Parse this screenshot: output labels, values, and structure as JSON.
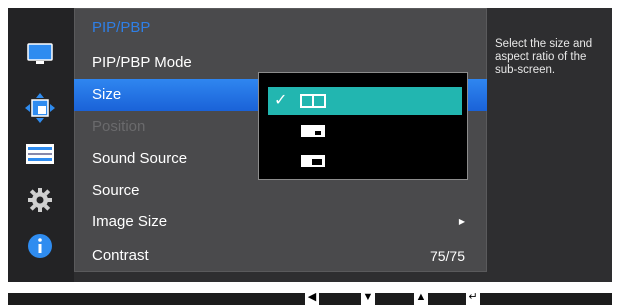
{
  "menu": {
    "title": "PIP/PBP",
    "items": [
      {
        "label": "PIP/PBP Mode"
      },
      {
        "label": "Size"
      },
      {
        "label": "Position"
      },
      {
        "label": "Sound Source"
      },
      {
        "label": "Source"
      },
      {
        "label": "Image Size"
      },
      {
        "label": "Contrast",
        "value": "75/75"
      }
    ]
  },
  "sub_options": [
    {
      "icon": "pbp-split-ratio-icon",
      "selected": true
    },
    {
      "icon": "pip-small-ratio-icon",
      "selected": false
    },
    {
      "icon": "pip-medium-ratio-icon",
      "selected": false
    }
  ],
  "help": {
    "text": "Select the size and aspect ratio of the sub-screen."
  },
  "rail_icons": [
    "monitor-icon",
    "pip-move-icon",
    "settings-bars-icon",
    "gear-icon",
    "info-icon"
  ],
  "guide_icons": [
    "left-arrow-icon",
    "down-arrow-icon",
    "up-arrow-icon",
    "enter-icon"
  ],
  "colors": {
    "accent_blue": "#2f7fe6",
    "selection_teal": "#22b6b0",
    "panel_bg": "#4a4a4c"
  }
}
